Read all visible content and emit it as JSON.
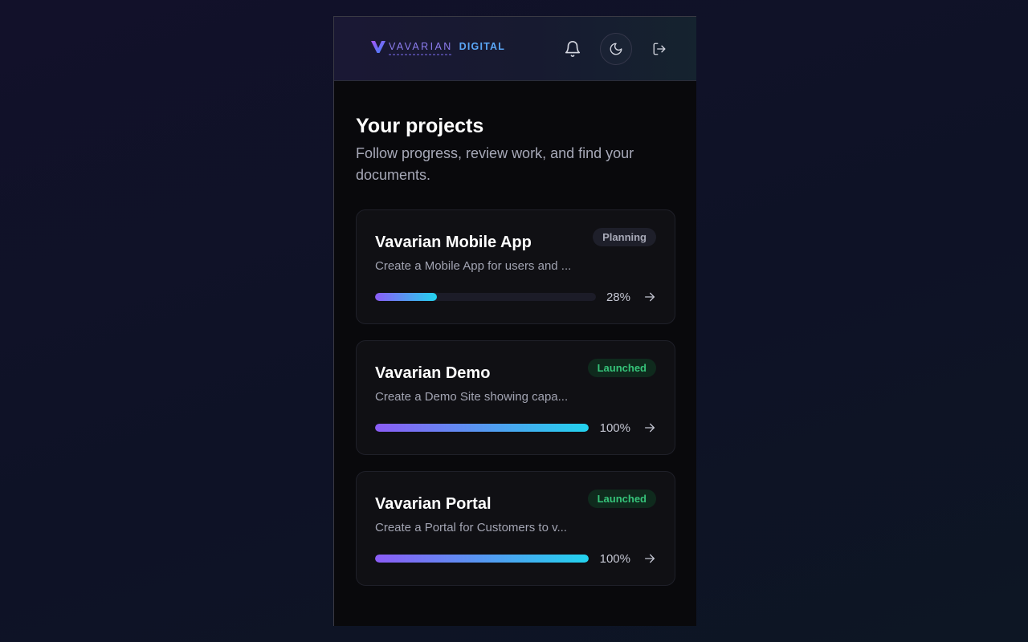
{
  "header": {
    "logo_brand": "VAVARIAN",
    "logo_sub": "DIGITAL",
    "icons": {
      "notifications": "bell-icon",
      "theme_toggle": "moon-icon",
      "logout": "logout-icon"
    }
  },
  "page": {
    "title": "Your projects",
    "subtitle": "Follow progress, review work, and find your documents."
  },
  "projects": [
    {
      "name": "Vavarian Mobile App",
      "status": "Planning",
      "description": "Create a Mobile App for users and ...",
      "progress": 28,
      "progress_label": "28%"
    },
    {
      "name": "Vavarian Demo",
      "status": "Launched",
      "description": "Create a Demo Site showing capa...",
      "progress": 100,
      "progress_label": "100%"
    },
    {
      "name": "Vavarian Portal",
      "status": "Launched",
      "description": "Create a Portal for Customers to v...",
      "progress": 100,
      "progress_label": "100%"
    }
  ],
  "colors": {
    "accent_gradient_start": "#8b5cf6",
    "accent_gradient_end": "#22d3ee",
    "status_planning": "#a8aab8",
    "status_launched": "#36c47a"
  }
}
